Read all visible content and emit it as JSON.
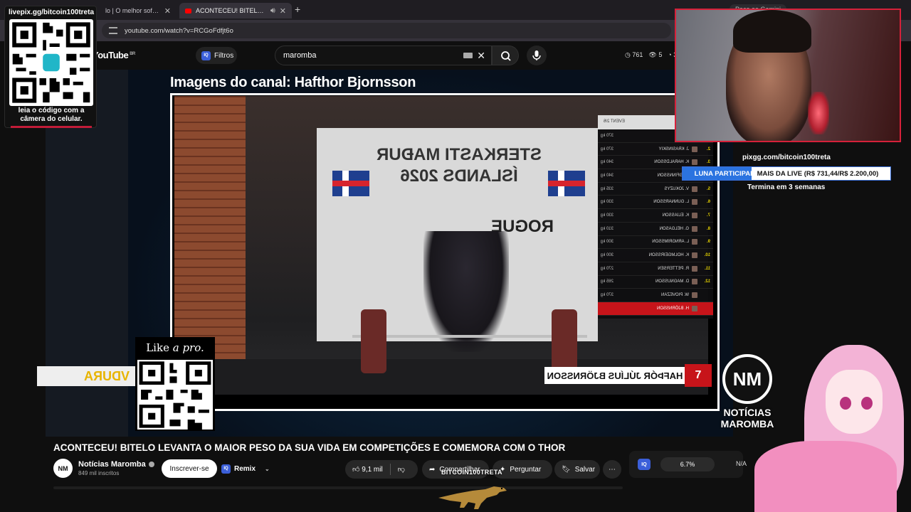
{
  "browser": {
    "tabs": [
      {
        "label": "lo | O melhor software p"
      },
      {
        "label": "ACONTECEU! BITELO LEVAN"
      }
    ],
    "new_tab": "+",
    "gemini_button": "Peça ao Gemini",
    "url": "youtube.com/watch?v=RCGoFdfjt6o"
  },
  "youtube": {
    "logo": "YouTube",
    "region": "BR",
    "filters_label": "Filtros",
    "search_value": "maromba",
    "header_stats": [
      "761",
      "5",
      "3"
    ]
  },
  "player": {
    "channel_header": "Imagens do canal: Hafthor Bjornsson",
    "banner_text": "STERKASTI MAÐUR ÍSLANDS 2026",
    "sponsor": "ROGUE",
    "lower_sponsor": "VDURA",
    "athlete_name": "HAFÞÓR JÚLÍUS BJÖRNSSON",
    "athlete_rank": "7",
    "board_header": "EVENT 2/6",
    "board_rows": [
      {
        "rank": "",
        "name": "SSON",
        "kg": "370 kg"
      },
      {
        "rank": "2.",
        "name": "J. KRASINSKIY",
        "kg": "370 kg"
      },
      {
        "rank": "3.",
        "name": "K. HARALDSSON",
        "kg": "340 kg"
      },
      {
        "rank": "4.",
        "name": "GUÐFINNSSON",
        "kg": "340 kg"
      },
      {
        "rank": "5.",
        "name": "V. JOKUZYS",
        "kg": "335 kg"
      },
      {
        "rank": "6.",
        "name": "L. GUNNARSSON",
        "kg": "330 kg"
      },
      {
        "rank": "7.",
        "name": "K. ELÍASSON",
        "kg": "330 kg"
      },
      {
        "rank": "8.",
        "name": "G. HELGASON",
        "kg": "310 kg"
      },
      {
        "rank": "9.",
        "name": "L. ARNGRÍMSSON",
        "kg": "300 kg"
      },
      {
        "rank": "10.",
        "name": "K. HÓLMGEIRSSON",
        "kg": "300 kg"
      },
      {
        "rank": "11.",
        "name": "R. PETTERSEN",
        "kg": "270 kg"
      },
      {
        "rank": "12.",
        "name": "D. MAGNÚSSON",
        "kg": "265 kg"
      },
      {
        "rank": "",
        "name": "W. PIOVEZAN",
        "kg": "370 kg"
      },
      {
        "rank": "",
        "name": "H. BJÖRNSSON",
        "kg": ""
      }
    ],
    "like_a_pro_prefix": "Like",
    "like_a_pro_italic": "a pro."
  },
  "overlay": {
    "qr_header": "livepix.gg/bitcoin100treta",
    "qr_footer": "leia o código com a câmera do celular.",
    "pix_url": "pixgg.com/bitcoin100treta",
    "goal_text_on": "LUNA PARTICIPAR",
    "goal_text_off": " MAIS DA LIVE (R$ 731,44/R$ 2.200,00)",
    "goal_progress": 0.332,
    "goal_ends": "Termina em 3 semanas",
    "nm_logo": "NM",
    "nm_line1": "NOTÍCIAS",
    "nm_line2": "MAROMBA",
    "hashtag": "BITCOIN100TRETA"
  },
  "video": {
    "title": "ACONTECEU! BITELO LEVANTA O MAIOR PESO DA SUA VIDA EM COMPETIÇÕES E COMEMORA COM O THOR",
    "channel": "Notícias Maromba",
    "subscribers": "849 mil inscritos",
    "subscribe_label": "Inscrever-se",
    "remix_label": "Remix",
    "likes": "9,1 mil",
    "share_label": "Compartilhar",
    "ask_label": "Perguntar",
    "save_label": "Salvar"
  },
  "extension": {
    "badge": "IQ",
    "percent": "6.7%",
    "na": "N/A"
  },
  "colors": {
    "accent_red": "#d6213a",
    "goal_blue": "#2b73e0",
    "iq_blue": "#3b5fd9"
  }
}
